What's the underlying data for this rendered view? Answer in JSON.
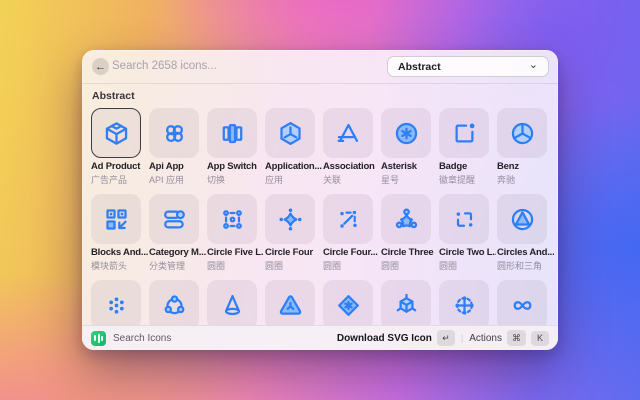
{
  "header": {
    "back_icon": "arrow-left",
    "search_placeholder": "Search 2658 icons...",
    "category_dropdown": {
      "value": "Abstract",
      "chevron_icon": "chevron-down"
    }
  },
  "section": {
    "title": "Abstract"
  },
  "grid": {
    "items": [
      {
        "icon": "ad-product",
        "label": "Ad Product",
        "label_zh": "广告产品",
        "selected": true
      },
      {
        "icon": "api-app",
        "label": "Api App",
        "label_zh": "API 应用",
        "selected": false
      },
      {
        "icon": "app-switch",
        "label": "App Switch",
        "label_zh": "切换",
        "selected": false
      },
      {
        "icon": "application-one",
        "label": "Application...",
        "label_zh": "应用",
        "selected": false
      },
      {
        "icon": "association",
        "label": "Association",
        "label_zh": "关联",
        "selected": false
      },
      {
        "icon": "asterisk",
        "label": "Asterisk",
        "label_zh": "星号",
        "selected": false
      },
      {
        "icon": "badge",
        "label": "Badge",
        "label_zh": "徽章提醒",
        "selected": false
      },
      {
        "icon": "benz",
        "label": "Benz",
        "label_zh": "奔驰",
        "selected": false
      },
      {
        "icon": "blocks-and-arrows",
        "label": "Blocks And...",
        "label_zh": "模块箭头",
        "selected": false
      },
      {
        "icon": "category-management",
        "label": "Category M...",
        "label_zh": "分类管理",
        "selected": false
      },
      {
        "icon": "circle-five-line",
        "label": "Circle Five L...",
        "label_zh": "圆圈",
        "selected": false
      },
      {
        "icon": "circle-four",
        "label": "Circle Four",
        "label_zh": "圆圈",
        "selected": false
      },
      {
        "icon": "circle-four-line",
        "label": "Circle Four...",
        "label_zh": "圆圈",
        "selected": false
      },
      {
        "icon": "circle-three",
        "label": "Circle Three",
        "label_zh": "圆圈",
        "selected": false
      },
      {
        "icon": "circle-two-line",
        "label": "Circle Two L...",
        "label_zh": "圆圈",
        "selected": false
      },
      {
        "icon": "circles-and-triangles",
        "label": "Circles And...",
        "label_zh": "圆形和三角",
        "selected": false
      },
      {
        "icon": "dots-cluster",
        "label": "",
        "label_zh": "",
        "selected": false
      },
      {
        "icon": "share-three",
        "label": "",
        "label_zh": "",
        "selected": false
      },
      {
        "icon": "cone",
        "label": "",
        "label_zh": "",
        "selected": false
      },
      {
        "icon": "triangle-round",
        "label": "",
        "label_zh": "",
        "selected": false
      },
      {
        "icon": "diamond-asterisk",
        "label": "",
        "label_zh": "",
        "selected": false
      },
      {
        "icon": "cube-three",
        "label": "",
        "label_zh": "",
        "selected": false
      },
      {
        "icon": "move-cross",
        "label": "",
        "label_zh": "",
        "selected": false
      },
      {
        "icon": "infinity",
        "label": "",
        "label_zh": "",
        "selected": false
      }
    ]
  },
  "footer": {
    "logo_icon": "iconpark-logo",
    "app_name": "Search Icons",
    "primary_action": {
      "label": "Download SVG Icon",
      "key": "↵"
    },
    "separator": "|",
    "secondary_action": {
      "label": "Actions",
      "keys": [
        "⌘",
        "K"
      ]
    }
  },
  "colors": {
    "icon_stroke": "#2E7EF5",
    "icon_fill_light": "#B3D0FA",
    "icon_fill_medium": "#8ABBF8",
    "selection_border": "#403C44",
    "logo_green": "#12B76A"
  }
}
